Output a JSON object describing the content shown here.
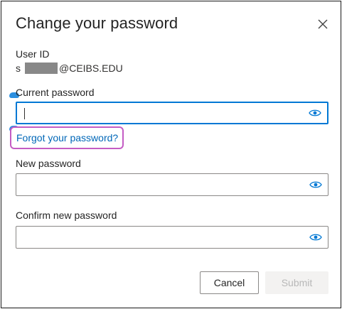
{
  "dialog": {
    "title": "Change your password",
    "close_icon": "close-icon"
  },
  "user": {
    "label": "User ID",
    "prefix": "s",
    "suffix": "@CEIBS.EDU"
  },
  "current_password": {
    "label": "Current password",
    "value": "",
    "placeholder": "",
    "focused": true,
    "icon": "eye-icon"
  },
  "forgot": {
    "label": "Forgot your password?"
  },
  "new_password": {
    "label": "New password",
    "value": "",
    "placeholder": "",
    "icon": "eye-icon"
  },
  "confirm_password": {
    "label": "Confirm new password",
    "value": "",
    "placeholder": "",
    "icon": "eye-icon"
  },
  "actions": {
    "cancel_label": "Cancel",
    "submit_label": "Submit",
    "submit_disabled": true
  },
  "colors": {
    "accent": "#0078d4",
    "link": "#0067b8",
    "highlight": "#c45cc4",
    "disabled_bg": "#f3f2f1",
    "disabled_text": "#b8b8b8"
  }
}
